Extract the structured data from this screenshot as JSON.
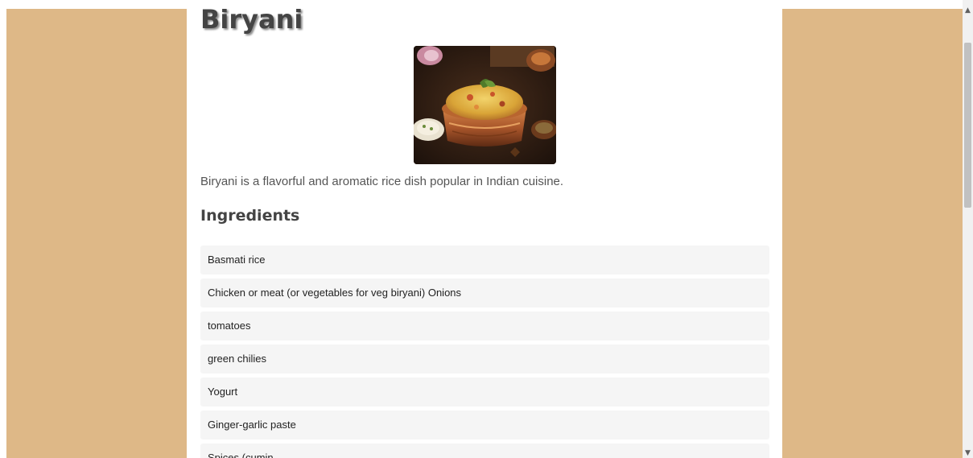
{
  "recipe": {
    "title": "Biryani",
    "description": "Biryani is a flavorful and aromatic rice dish popular in Indian cuisine."
  },
  "ingredients": {
    "heading": "Ingredients",
    "items": [
      "Basmati rice",
      "Chicken or meat (or vegetables for veg biryani) Onions",
      "tomatoes",
      "green chilies",
      "Yogurt",
      "Ginger-garlic paste",
      "Spices (cumin"
    ]
  },
  "scrollbar": {
    "up_icon": "chevron-up-icon",
    "down_icon": "chevron-down-icon"
  },
  "colors": {
    "page_background": "#deb887",
    "content_background": "#ffffff",
    "list_item_background": "#f5f5f5",
    "heading_text": "#444444"
  }
}
